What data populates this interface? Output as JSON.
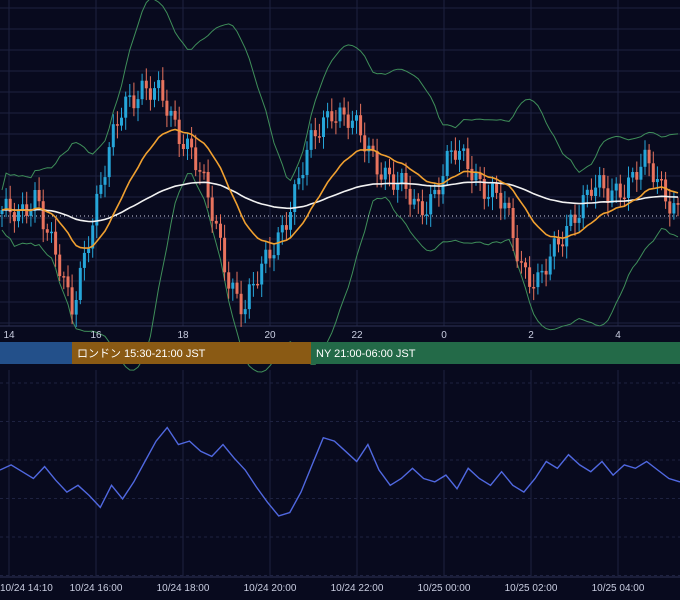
{
  "colors": {
    "background": "#080a1e",
    "grid": "#1e2240",
    "candle_up": "#26a6d9",
    "candle_down": "#e8735e",
    "ma_short": "#f0a030",
    "ma_long": "#f2f2f2",
    "bollinger": "#3f8f5a",
    "oscillator": "#5068e0",
    "session_tokyo": "#23508a",
    "session_london": "#8a5a14",
    "session_ny": "#236a48"
  },
  "chart_data": [
    {
      "type": "candlestick",
      "x_tick_labels": [
        "14",
        "16",
        "18",
        "20",
        "22",
        "0",
        "2",
        "4"
      ],
      "overlays": [
        "bollinger-bands",
        "moving-average-short",
        "moving-average-long",
        "dotted-reference-line"
      ],
      "approx_close_path": [
        0.55,
        0.52,
        0.6,
        0.45,
        0.3,
        0.5,
        0.65,
        0.8,
        0.85,
        0.82,
        0.75,
        0.7,
        0.55,
        0.4,
        0.32,
        0.4,
        0.5,
        0.6,
        0.72,
        0.8,
        0.76,
        0.7,
        0.65,
        0.6,
        0.55,
        0.6,
        0.68,
        0.66,
        0.6,
        0.55,
        0.42,
        0.38,
        0.45,
        0.55,
        0.6,
        0.58,
        0.62,
        0.66,
        0.6,
        0.56
      ]
    },
    {
      "type": "line",
      "series": [
        {
          "values": [
            55,
            58,
            54,
            50,
            57,
            49,
            42,
            46,
            40,
            33,
            46,
            38,
            48,
            60,
            72,
            80,
            70,
            72,
            66,
            63,
            70,
            62,
            55,
            45,
            36,
            28,
            30,
            42,
            58,
            74,
            72,
            66,
            60,
            70,
            55,
            46,
            50,
            56,
            50,
            48,
            52,
            44,
            56,
            50,
            46,
            54,
            46,
            42,
            50,
            60,
            56,
            64,
            58,
            54,
            60,
            52,
            58,
            56,
            60,
            55,
            50,
            48
          ]
        }
      ],
      "x_tick_labels": [
        "10/24 14:10",
        "10/24 16:00",
        "10/24 18:00",
        "10/24 20:00",
        "10/24 22:00",
        "10/25 00:00",
        "10/25 02:00",
        "10/25 04:00"
      ]
    }
  ],
  "sessions": [
    {
      "label": ""
    },
    {
      "label": "ロンドン 15:30-21:00 JST"
    },
    {
      "label": "NY 21:00-06:00 JST"
    }
  ]
}
